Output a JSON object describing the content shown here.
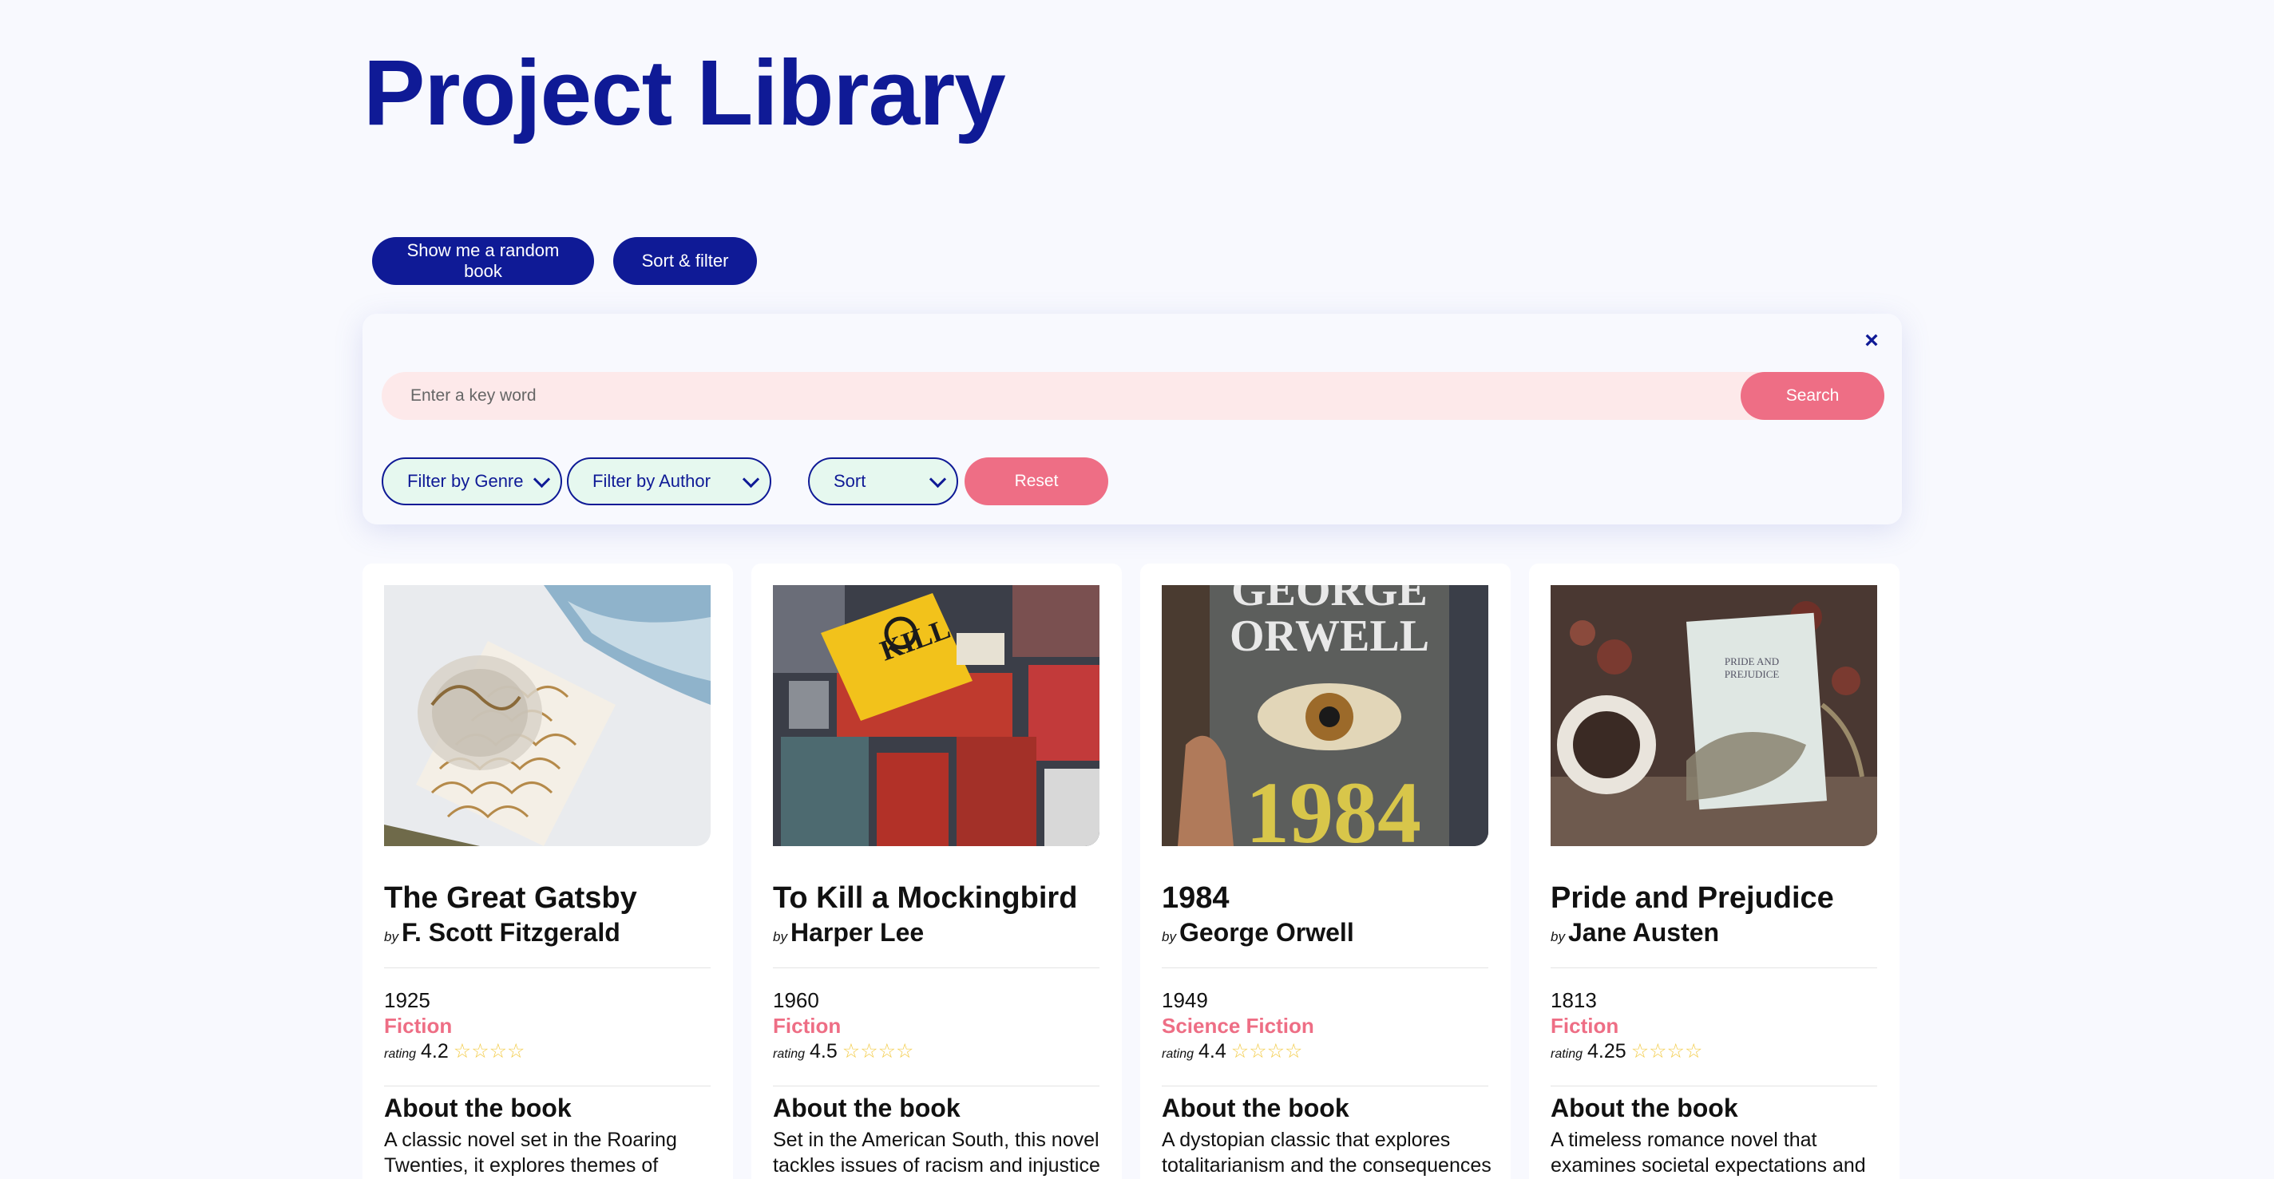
{
  "page": {
    "title": "Project Library"
  },
  "actions": {
    "random_label": "Show me a random book",
    "sort_filter_label": "Sort & filter"
  },
  "filter": {
    "close_glyph": "×",
    "search_placeholder": "Enter a key word",
    "search_value": "",
    "search_label": "Search",
    "genre_label": "Filter by Genre",
    "author_label": "Filter by Author",
    "sort_label": "Sort",
    "reset_label": "Reset"
  },
  "labels": {
    "by": "by",
    "rating": "rating",
    "about": "About the book"
  },
  "books": [
    {
      "title": "The Great Gatsby",
      "author": "F. Scott Fitzgerald",
      "year": "1925",
      "genre": "Fiction",
      "rating": "4.2",
      "stars": "☆☆☆☆",
      "about": "A classic novel set in the Roaring Twenties, it explores themes of",
      "cover": "gatsby-cover"
    },
    {
      "title": "To Kill a Mockingbird",
      "author": "Harper Lee",
      "year": "1960",
      "genre": "Fiction",
      "rating": "4.5",
      "stars": "☆☆☆☆",
      "about": "Set in the American South, this novel tackles issues of racism and injustice",
      "cover": "mockingbird-cover"
    },
    {
      "title": "1984",
      "author": "George Orwell",
      "year": "1949",
      "genre": "Science Fiction",
      "rating": "4.4",
      "stars": "☆☆☆☆",
      "about": "A dystopian classic that explores totalitarianism and the consequences",
      "cover": "1984-cover",
      "cover_text": {
        "top": "GEORGE",
        "middle": "ORWELL",
        "bottom": "1984"
      }
    },
    {
      "title": "Pride and Prejudice",
      "author": "Jane Austen",
      "year": "1813",
      "genre": "Fiction",
      "rating": "4.25",
      "stars": "☆☆☆☆",
      "about": "A timeless romance novel that examines societal expectations and",
      "cover": "pride-cover"
    }
  ],
  "colors": {
    "primary": "#0f1a96",
    "accent": "#ee6e85",
    "search_bg": "#fde9ea",
    "select_bg": "#e6f8ef",
    "star": "#f3cc4a",
    "page_bg": "#f8f9fe"
  }
}
